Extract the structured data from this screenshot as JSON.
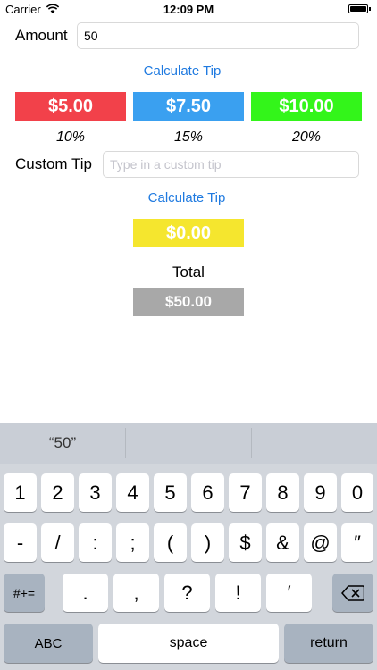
{
  "status_bar": {
    "carrier": "Carrier",
    "time": "12:09 PM"
  },
  "amount": {
    "label": "Amount",
    "value": "50"
  },
  "calculate_tip_1": "Calculate Tip",
  "tip_options": [
    {
      "amount": "$5.00",
      "percent": "10%",
      "color": "#f2414a"
    },
    {
      "amount": "$7.50",
      "percent": "15%",
      "color": "#3aa0f0"
    },
    {
      "amount": "$10.00",
      "percent": "20%",
      "color": "#33f51a"
    }
  ],
  "custom_tip": {
    "label": "Custom Tip",
    "placeholder": "Type in a custom tip"
  },
  "calculate_tip_2": "Calculate Tip",
  "custom_result": {
    "amount": "$0.00",
    "color": "#f5e62e"
  },
  "total": {
    "label": "Total",
    "amount": "$50.00",
    "color": "#a8a8a8"
  },
  "keyboard": {
    "suggestions": [
      "“50”",
      "",
      ""
    ],
    "row1": [
      "1",
      "2",
      "3",
      "4",
      "5",
      "6",
      "7",
      "8",
      "9",
      "0"
    ],
    "row2": [
      "-",
      "/",
      ":",
      ";",
      "(",
      ")",
      "$",
      "&",
      "@",
      "″"
    ],
    "row3_left": "#+=",
    "row3": [
      ".",
      ",",
      "?",
      "!",
      "′"
    ],
    "abc": "ABC",
    "space": "space",
    "return": "return"
  }
}
